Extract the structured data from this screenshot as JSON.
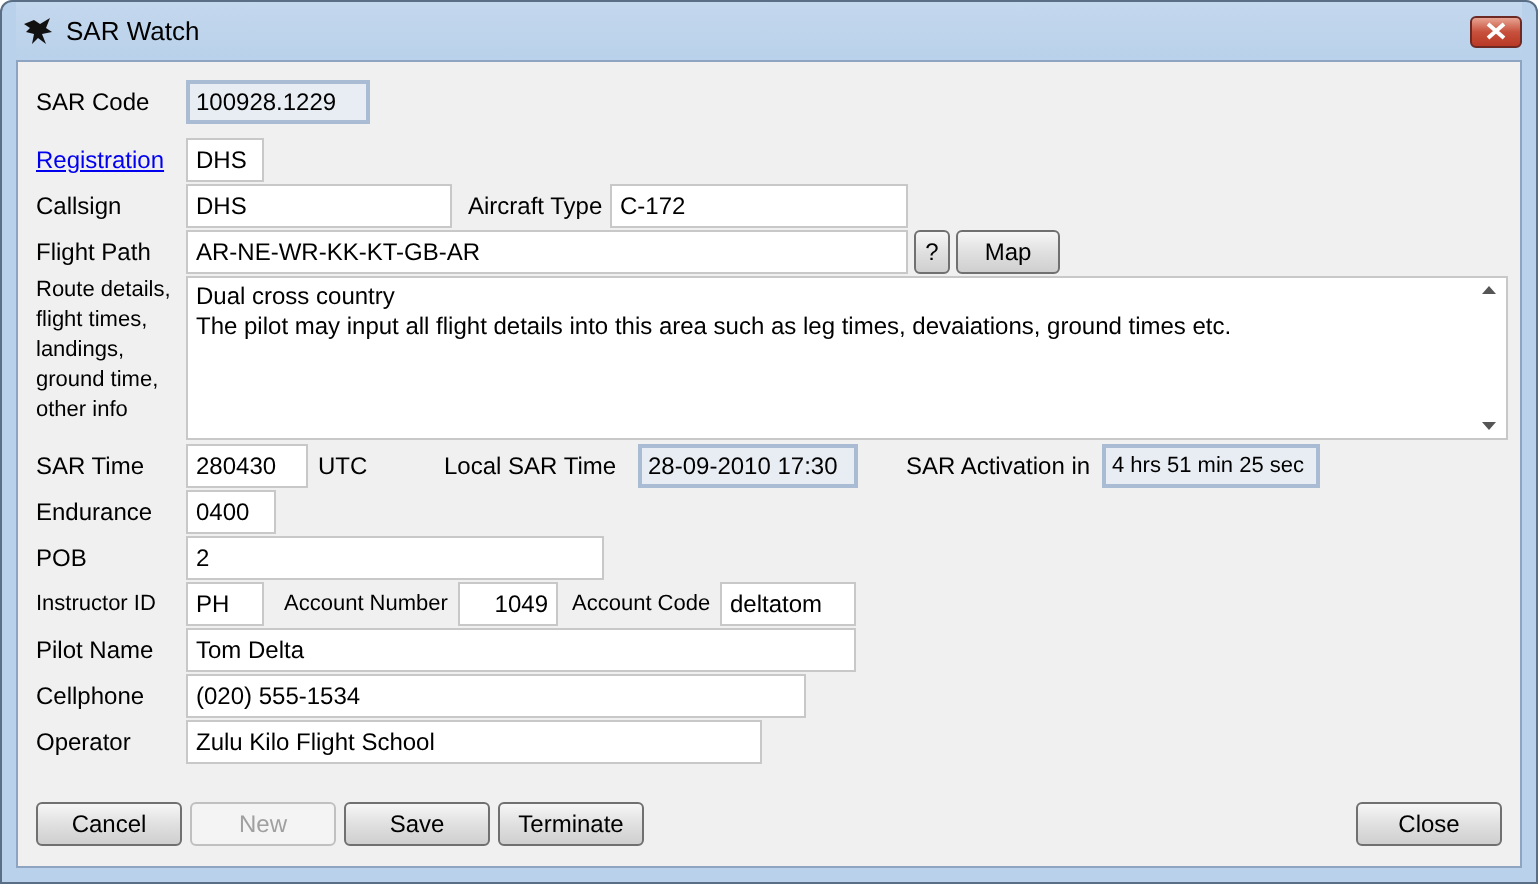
{
  "window": {
    "title": "SAR Watch"
  },
  "sar_code": {
    "label": "SAR Code",
    "value": "100928.1229"
  },
  "registration": {
    "label": "Registration",
    "value": "DHS"
  },
  "callsign": {
    "label": "Callsign",
    "value": "DHS"
  },
  "aircraft_type": {
    "label": "Aircraft Type",
    "value": "C-172"
  },
  "flight_path": {
    "label": "Flight Path",
    "value": "AR-NE-WR-KK-KT-GB-AR"
  },
  "help_button": "?",
  "map_button": "Map",
  "route_details": {
    "label": "Route details, flight times, landings, ground time, other info",
    "value": "Dual cross country\nThe pilot may input all flight details into this area such as leg times, devaiations, ground times etc."
  },
  "sar_time": {
    "label": "SAR Time",
    "value": "280430",
    "unit": "UTC"
  },
  "local_sar_time": {
    "label": "Local SAR Time",
    "value": "28-09-2010 17:30"
  },
  "sar_activation": {
    "label": "SAR Activation in",
    "value": "4 hrs 51 min 25 sec"
  },
  "endurance": {
    "label": "Endurance",
    "value": "0400"
  },
  "pob": {
    "label": "POB",
    "value": "2"
  },
  "instructor_id": {
    "label": "Instructor ID",
    "value": "PH"
  },
  "account_number": {
    "label": "Account Number",
    "value": "1049"
  },
  "account_code": {
    "label": "Account Code",
    "value": "deltatom"
  },
  "pilot_name": {
    "label": "Pilot Name",
    "value": "Tom Delta"
  },
  "cellphone": {
    "label": "Cellphone",
    "value": "(020) 555-1534"
  },
  "operator": {
    "label": "Operator",
    "value": "Zulu Kilo Flight School"
  },
  "buttons": [
    {
      "label": "Cancel",
      "disabled": false
    },
    {
      "label": "New",
      "disabled": true
    },
    {
      "label": "Save",
      "disabled": false
    },
    {
      "label": "Terminate",
      "disabled": false
    }
  ],
  "close_button": {
    "label": "Close",
    "disabled": false
  }
}
